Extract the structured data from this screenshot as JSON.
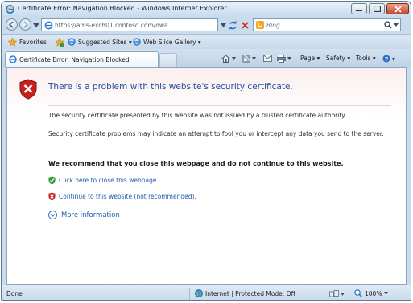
{
  "window": {
    "title": "Certificate Error: Navigation Blocked - Windows Internet Explorer"
  },
  "address_bar": {
    "url": "https://ams-exch01.contoso.com/owa",
    "search_placeholder": "Bing"
  },
  "favorites_bar": {
    "favorites_label": "Favorites",
    "items": [
      {
        "label": "Suggested Sites ▾",
        "icon": "suggested-sites-icon"
      },
      {
        "label": "Web Slice Gallery ▾",
        "icon": "web-slice-icon"
      }
    ]
  },
  "tabs": [
    {
      "label": "Certificate Error: Navigation Blocked",
      "active": true
    }
  ],
  "command_bar": {
    "page_label": "Page ▾",
    "safety_label": "Safety ▾",
    "tools_label": "Tools ▾",
    "help_label": "▾"
  },
  "content": {
    "heading": "There is a problem with this website's security certificate.",
    "paragraph1": "The security certificate presented by this website was not issued by a trusted certificate authority.",
    "paragraph2": "Security certificate problems may indicate an attempt to fool you or intercept any data you send to the server.",
    "recommendation": "We recommend that you close this webpage and do not continue to this website.",
    "close_link": "Click here to close this webpage.",
    "continue_link": "Continue to this website (not recommended).",
    "more_info": "More information"
  },
  "status_bar": {
    "status": "Done",
    "zone": "Internet | Protected Mode: Off",
    "zoom": "100%"
  },
  "colors": {
    "link": "#1f5ea8",
    "heading": "#1f4e9a",
    "shield_red": "#c8201c",
    "shield_green": "#2f9a2f"
  }
}
